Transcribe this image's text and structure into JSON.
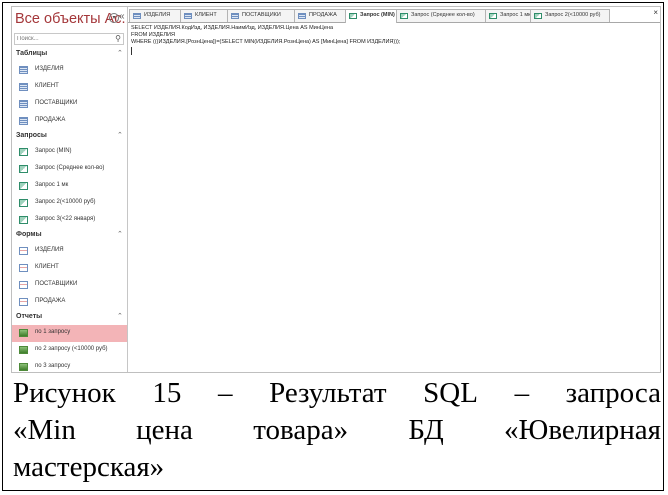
{
  "nav": {
    "title": "Все объекты Ac...",
    "menu_icon": "circle-chevron-icon",
    "collapse_icon": "double-chevron-left-icon",
    "search_placeholder": "Поиск...",
    "groups": [
      {
        "label": "Таблицы",
        "items": [
          "ИЗДЕЛИЯ",
          "КЛИЕНТ",
          "ПОСТАВЩИКИ",
          "ПРОДАЖА"
        ]
      },
      {
        "label": "Запросы",
        "items": [
          "Запрос (MIN)",
          "Запрос (Среднее кол-во)",
          "Запрос 1 мк",
          "Запрос 2(<10000 руб)",
          "Запрос 3(<22 января)"
        ]
      },
      {
        "label": "Формы",
        "items": [
          "ИЗДЕЛИЯ",
          "КЛИЕНТ",
          "ПОСТАВЩИКИ",
          "ПРОДАЖА"
        ]
      },
      {
        "label": "Отчеты",
        "items": [
          "по 1 запросу",
          "по 2 запросу (<10000 руб)",
          "по 3 запросу"
        ]
      }
    ],
    "selected_item": "по 1 запросу",
    "selected_color": "#f3b4b7"
  },
  "tabs": [
    "ИЗДЕЛИЯ",
    "КЛИЕНТ",
    "ПОСТАВЩИКИ",
    "ПРОДАЖА",
    "Запрос (MIN)",
    "Запрос (Среднее кол-во)",
    "Запрос 1 мк",
    "Запрос 2(<10000 руб)"
  ],
  "active_tab": "Запрос (MIN)",
  "sql_lines": [
    "SELECT ИЗДЕЛИЯ.КодИзд, ИЗДЕЛИЯ.НаимИзд, ИЗДЕЛИЯ.Цена AS МинЦена",
    "FROM ИЗДЕЛИЯ",
    "WHERE (((ИЗДЕЛИЯ.[РознЦена])=(SELECT MIN(ИЗДЕЛИЯ.РознЦена) AS [МинЦена] FROM ИЗДЕЛИЯ)));"
  ],
  "caption": {
    "line1": [
      "Рисунок",
      "15",
      "–",
      "Результат",
      "SQL",
      "–",
      "запроса"
    ],
    "line2": [
      "«Min",
      "цена",
      "товара»",
      "БД",
      "«Ювелирная"
    ],
    "line3": "мастерская»"
  }
}
